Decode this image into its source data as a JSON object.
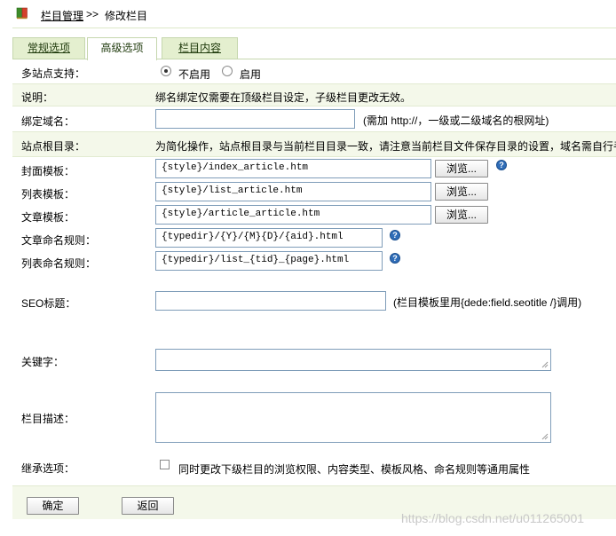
{
  "breadcrumb": {
    "link": "栏目管理",
    "separator": ">>",
    "current": "修改栏目"
  },
  "tabs": [
    {
      "label": "常规选项",
      "active": false
    },
    {
      "label": "高级选项",
      "active": true
    },
    {
      "label": "栏目内容",
      "active": false
    }
  ],
  "form": {
    "multisite": {
      "label": "多站点支持：",
      "options": [
        "不启用",
        "启用"
      ],
      "selected": "不启用"
    },
    "note": {
      "label": "说明：",
      "text": "绑名绑定仅需要在顶级栏目设定，子级栏目更改无效。"
    },
    "domain": {
      "label": "绑定域名：",
      "value": "",
      "hint": "(需加 http://，一级或二级域名的根网址)"
    },
    "siteroot": {
      "label": "站点根目录：",
      "text": "为简化操作，站点根目录与当前栏目目录一致，请注意当前栏目文件保存目录的设置，域名需自行手"
    },
    "cover_template": {
      "label": "封面模板：",
      "value": "{style}/index_article.htm",
      "browse": "浏览..."
    },
    "list_template": {
      "label": "列表模板：",
      "value": "{style}/list_article.htm",
      "browse": "浏览..."
    },
    "article_template": {
      "label": "文章模板：",
      "value": "{style}/article_article.htm",
      "browse": "浏览..."
    },
    "article_rule": {
      "label": "文章命名规则：",
      "value": "{typedir}/{Y}/{M}{D}/{aid}.html"
    },
    "list_rule": {
      "label": "列表命名规则：",
      "value": "{typedir}/list_{tid}_{page}.html"
    },
    "seo_title": {
      "label": "SEO标题：",
      "value": "",
      "hint": "(栏目模板里用{dede:field.seotitle /}调用)"
    },
    "keywords": {
      "label": "关键字：",
      "value": ""
    },
    "description": {
      "label": "栏目描述：",
      "value": ""
    },
    "inherit": {
      "label": "继承选项：",
      "checkbox_label": "同时更改下级栏目的浏览权限、内容类型、模板风格、命名规则等通用属性",
      "checked": false
    }
  },
  "buttons": {
    "ok": "确定",
    "back": "返回"
  },
  "watermark": "https://blog.csdn.net/u011265001",
  "colors": {
    "tab_bg": "#e4efcf",
    "tab_border": "#c6d7ae",
    "row_tint": "#f4f8ea",
    "help_icon": "#2f6db8"
  }
}
